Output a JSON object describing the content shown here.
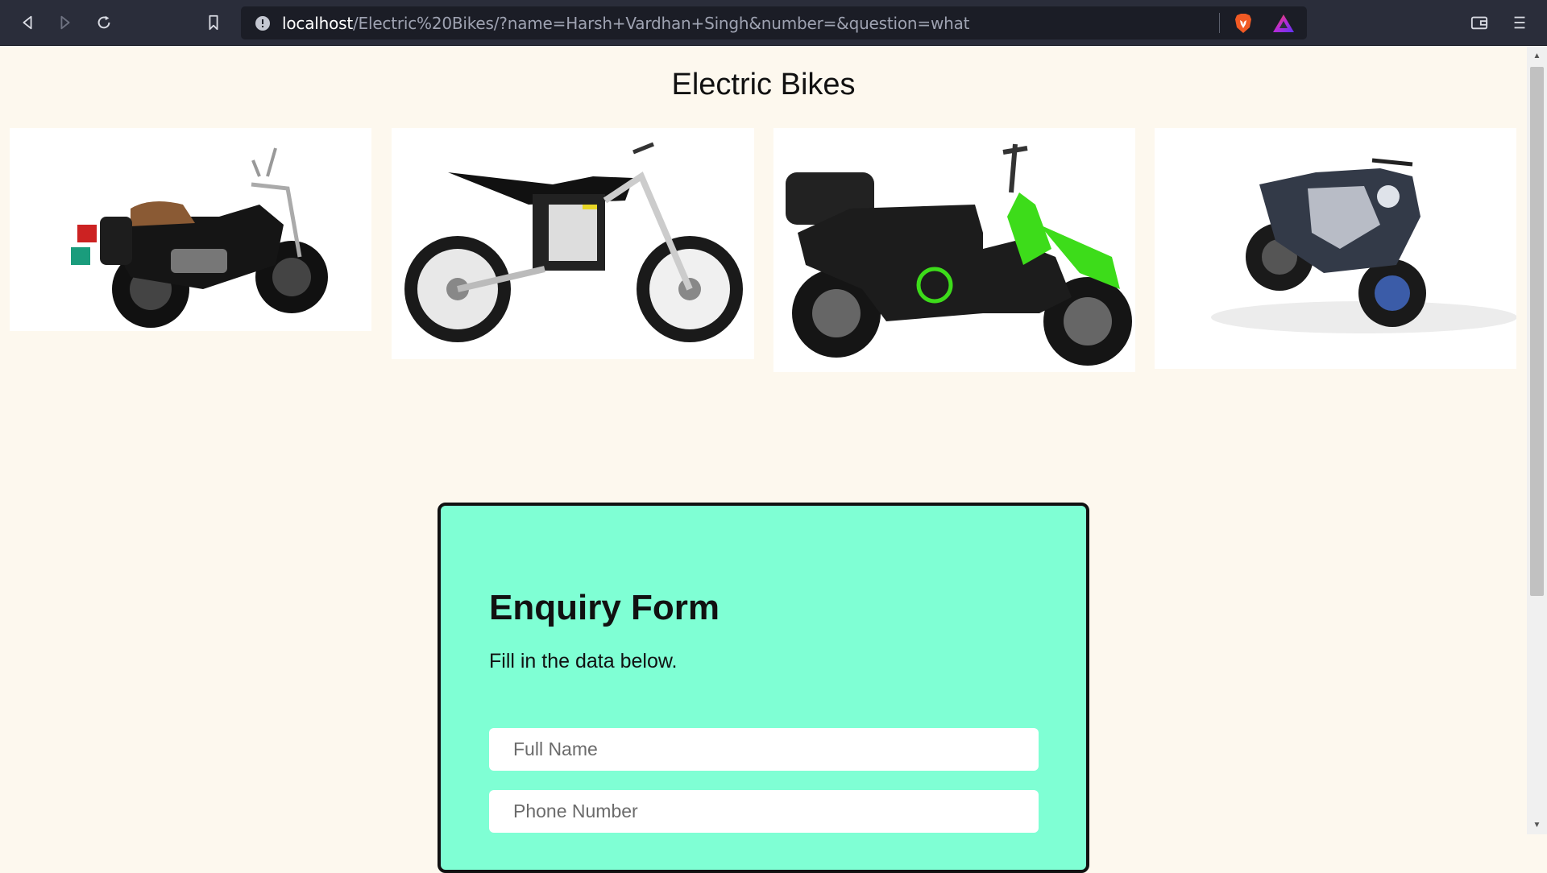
{
  "browser": {
    "url_host": "localhost",
    "url_path": "/Electric%20Bikes/?name=Harsh+Vardhan+Singh&number=&question=what",
    "icons": {
      "back": "back-arrow-icon",
      "forward": "forward-arrow-icon",
      "reload": "reload-icon",
      "bookmark": "bookmark-icon",
      "site_info": "info-icon",
      "brave_shields": "brave-lion-icon",
      "brave_rewards": "rewards-triangle-icon",
      "wallet": "wallet-icon",
      "menu": "hamburger-menu-icon"
    }
  },
  "page": {
    "title": "Electric Bikes",
    "gallery": [
      {
        "name": "cruiser-motorcycle",
        "color": "#111111"
      },
      {
        "name": "dirt-bike",
        "color": "#1a1a1a"
      },
      {
        "name": "green-scooter",
        "color": "#3ddc1a"
      },
      {
        "name": "sport-electric-bike",
        "color": "#333a48"
      }
    ]
  },
  "form": {
    "title": "Enquiry Form",
    "subtitle": "Fill in the data below.",
    "full_name_placeholder": "Full Name",
    "phone_placeholder": "Phone Number",
    "background": "#7fffd4"
  },
  "colors": {
    "page_background": "#fdf8ee",
    "toolbar": "#2a2d3a",
    "url_bar": "#1b1d26"
  }
}
